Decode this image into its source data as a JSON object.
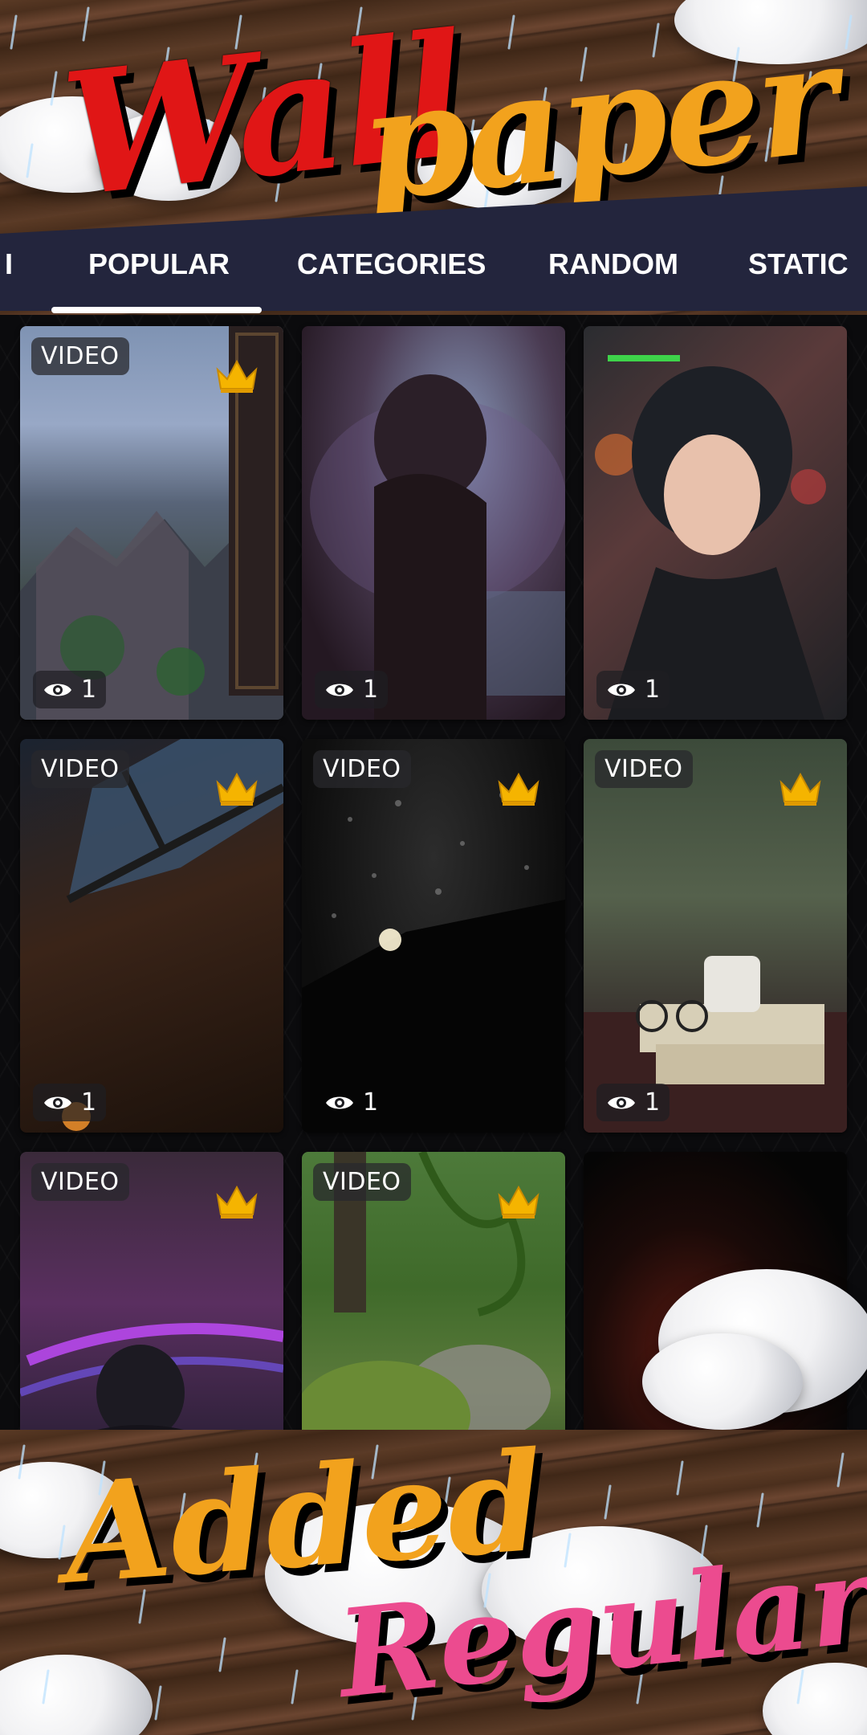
{
  "header": {
    "title_part1": "Wall",
    "title_part2": "paper"
  },
  "tabs": [
    {
      "label": "I"
    },
    {
      "label": "POPULAR",
      "selected": true
    },
    {
      "label": "CATEGORIES"
    },
    {
      "label": "RANDOM"
    },
    {
      "label": "STATIC"
    }
  ],
  "cards": [
    {
      "badge": "VIDEO",
      "premium": true,
      "views": "1",
      "theme": "mountain village in rain"
    },
    {
      "badge": "",
      "premium": false,
      "views": "1",
      "theme": "girl with umbrella"
    },
    {
      "badge": "",
      "premium": false,
      "views": "1",
      "theme": "girl in neon rain"
    },
    {
      "badge": "VIDEO",
      "premium": true,
      "views": "1",
      "theme": "attic skylight"
    },
    {
      "badge": "VIDEO",
      "premium": true,
      "views": "1",
      "theme": "raindrops on glass"
    },
    {
      "badge": "VIDEO",
      "premium": true,
      "views": "1",
      "theme": "cup and glasses by window"
    },
    {
      "badge": "VIDEO",
      "premium": true,
      "views": "",
      "theme": "neon sign girl"
    },
    {
      "badge": "VIDEO",
      "premium": true,
      "views": "",
      "theme": "forest moss"
    },
    {
      "badge": "",
      "premium": false,
      "views": "",
      "theme": "dark red rain window"
    }
  ],
  "promo": {
    "line1": "Added",
    "line2": "Regularly"
  },
  "colors": {
    "title_red": "#e01616",
    "title_orange": "#f2a21d",
    "nav_band": "#23253d",
    "promo_pink": "#ec4b8f",
    "crown_gold": "#f5b400"
  },
  "icons": {
    "views": "eye-icon",
    "premium": "crown-icon"
  }
}
